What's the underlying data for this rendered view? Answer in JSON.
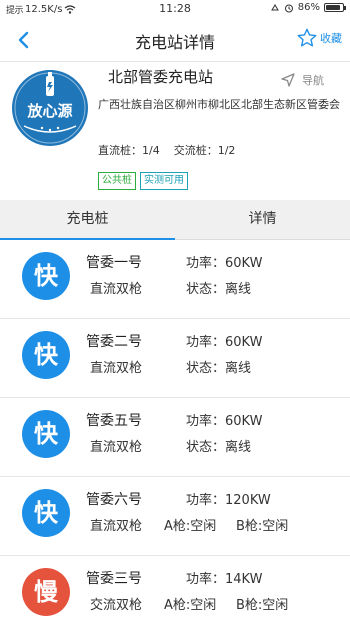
{
  "statusbar": {
    "left_text": "12.5K/s",
    "left_small": "提示",
    "time": "11:28",
    "battery": "86%",
    "battery_level": 0.86
  },
  "header": {
    "title": "充电站详情",
    "favorite_label": "收藏",
    "accent": "#1e8fe6"
  },
  "station": {
    "logo_text": "放心源",
    "name": "北部管委充电站",
    "nav_label": "导航",
    "address": "广西壮族自治区柳州市柳北区北部生态新区管委会",
    "dc_count": "直流桩：1/4",
    "ac_count": "交流桩：1/2",
    "tags": [
      "公共桩",
      "实测可用"
    ]
  },
  "tabs": [
    {
      "label": "充电桩",
      "active": true
    },
    {
      "label": "详情",
      "active": false
    }
  ],
  "chargers": [
    {
      "badge": "快",
      "kind": "fast",
      "name": "管委一号",
      "type": "直流双枪",
      "power": "功率：60KW",
      "status": "状态：离线"
    },
    {
      "badge": "快",
      "kind": "fast",
      "name": "管委二号",
      "type": "直流双枪",
      "power": "功率：60KW",
      "status": "状态：离线"
    },
    {
      "badge": "快",
      "kind": "fast",
      "name": "管委五号",
      "type": "直流双枪",
      "power": "功率：60KW",
      "status": "状态：离线"
    },
    {
      "badge": "快",
      "kind": "fast",
      "name": "管委六号",
      "type": "直流双枪",
      "power": "功率：120KW",
      "gun_a": "A枪:空闲",
      "gun_b": "B枪:空闲"
    },
    {
      "badge": "慢",
      "kind": "slow",
      "name": "管委三号",
      "type": "交流双枪",
      "power": "功率：14KW",
      "gun_a": "A枪:空闲",
      "gun_b": "B枪:空闲"
    }
  ]
}
